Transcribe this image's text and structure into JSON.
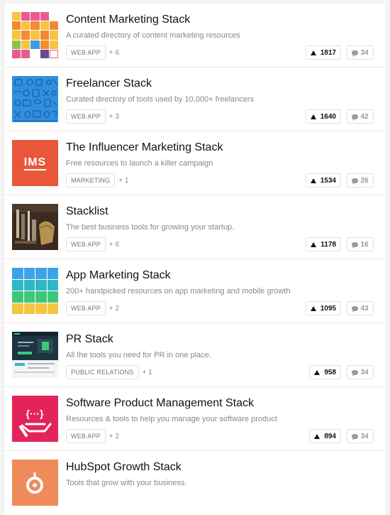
{
  "items": [
    {
      "title": "Content Marketing Stack",
      "tagline": "A curated directory of content marketing resources",
      "tag": "WEB APP",
      "more": "+ 6",
      "votes": "1817",
      "comments": "34",
      "thumb_icon": "content-marketing-mosaic"
    },
    {
      "title": "Freelancer Stack",
      "tagline": "Curated directory of tools used by 10,000+ freelancers",
      "tag": "WEB APP",
      "more": "+ 3",
      "votes": "1640",
      "comments": "42",
      "thumb_icon": "freelancer-doodle-pattern"
    },
    {
      "title": "The Influencer Marketing Stack",
      "tagline": "Free resources to launch a killer campaign",
      "tag": "MARKETING",
      "more": "+ 1",
      "votes": "1534",
      "comments": "26",
      "thumb_icon": "ims-logo",
      "thumb_text": "IMS"
    },
    {
      "title": "Stacklist",
      "tagline": "The best business tools for growing your startup.",
      "tag": "WEB APP",
      "more": "+ 6",
      "votes": "1178",
      "comments": "16",
      "thumb_icon": "tools-photo"
    },
    {
      "title": "App Marketing Stack",
      "tagline": "200+ handpicked resources on app marketing and mobile growth",
      "tag": "WEB APP",
      "more": "+ 2",
      "votes": "1095",
      "comments": "43",
      "thumb_icon": "app-marketing-grid"
    },
    {
      "title": "PR Stack",
      "tagline": "All the tools you need for PR in one place.",
      "tag": "PUBLIC RELATIONS",
      "more": "+ 1",
      "votes": "958",
      "comments": "34",
      "thumb_icon": "pr-stack-screenshot"
    },
    {
      "title": "Software Product Management Stack",
      "tagline": "Resources & tools to help you manage your software product",
      "tag": "WEB APP",
      "more": "+ 2",
      "votes": "894",
      "comments": "34",
      "thumb_icon": "hand-braces-logo"
    },
    {
      "title": "HubSpot Growth Stack",
      "tagline": "Tools that grow with your business.",
      "tag": "",
      "more": "",
      "votes": "",
      "comments": "",
      "thumb_icon": "hubspot-logo"
    }
  ],
  "colors": {
    "ims": "#e8573a",
    "spm": "#e3245a",
    "hubspot": "#ef8a5b"
  }
}
